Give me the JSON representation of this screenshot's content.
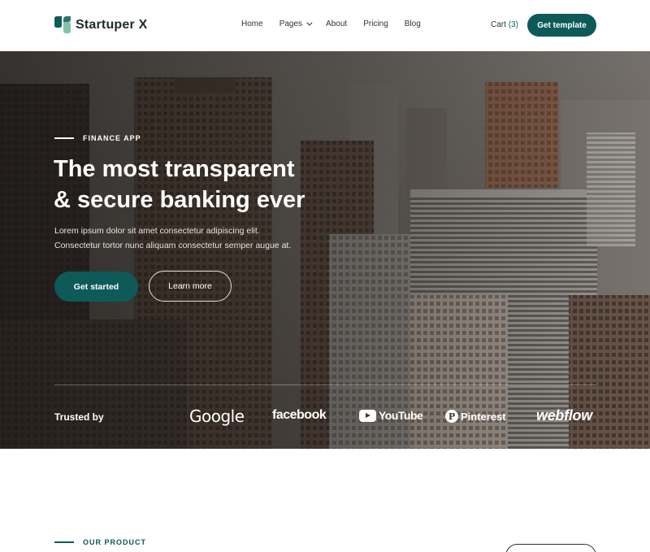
{
  "header": {
    "brand_name": "Startuper X",
    "nav": [
      "Home",
      "Pages",
      "About",
      "Pricing",
      "Blog"
    ],
    "cart_label": "Cart",
    "cart_count": "(3)",
    "cta_label": "Get template"
  },
  "hero": {
    "eyebrow": "FINANCE APP",
    "title_line1": "The most transparent",
    "title_line2": "& secure banking ever",
    "desc_line1": "Lorem ipsum dolor sit amet consectetur adipiscing elit.",
    "desc_line2": "Consectetur tortor nunc aliquam consectetur semper augue at.",
    "primary_button": "Get started",
    "secondary_button": "Learn more",
    "trusted_label": "Trusted by",
    "brands": {
      "google": "Google",
      "facebook": "facebook",
      "youtube": "YouTube",
      "pinterest": "Pinterest",
      "webflow": "webflow"
    }
  },
  "product": {
    "eyebrow": "OUR PRODUCT"
  },
  "colors": {
    "accent": "#0d5a58",
    "text_dark": "#1f2b2b"
  }
}
